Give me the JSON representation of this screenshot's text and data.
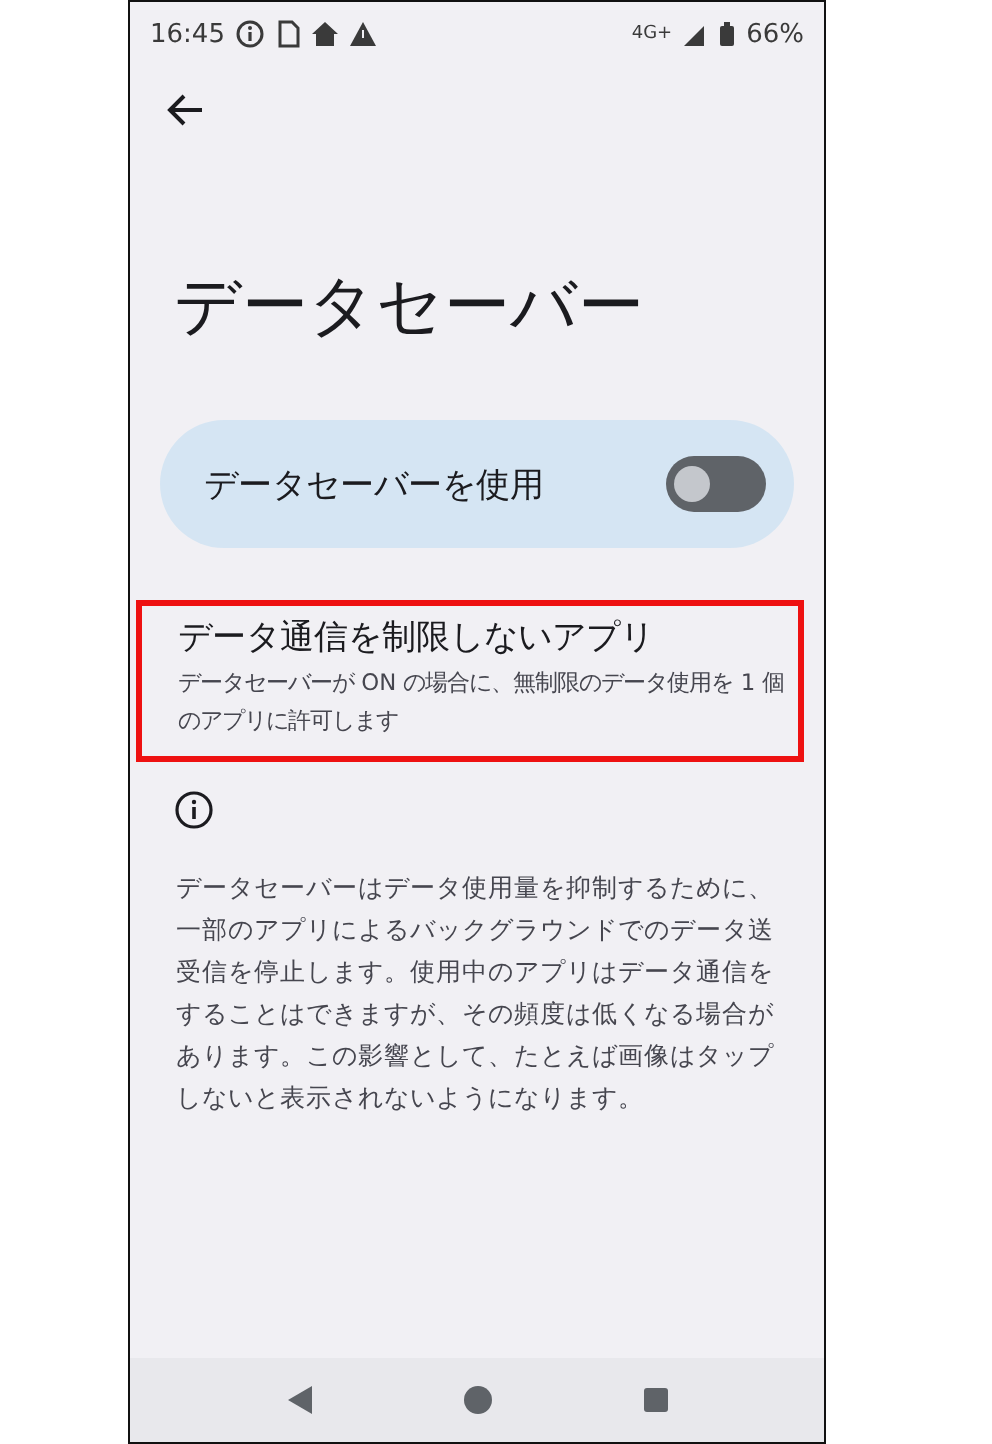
{
  "status_bar": {
    "time": "16:45",
    "network": "4G+",
    "battery": "66%"
  },
  "title": "データセーバー",
  "master_switch": {
    "label": "データセーバーを使用",
    "on": false
  },
  "unrestricted_apps": {
    "title": "データ通信を制限しないアプリ",
    "summary": "データセーバーが ON の場合に、無制限のデータ使用を 1 個のアプリに許可します",
    "highlighted": true
  },
  "description": "データセーバーはデータ使用量を抑制するために、一部のアプリによるバックグラウンドでのデータ送受信を停止します。使用中のアプリはデータ通信をすることはできますが、その頻度は低くなる場合があります。この影響として、たとえば画像はタップしないと表示されないようになります。"
}
